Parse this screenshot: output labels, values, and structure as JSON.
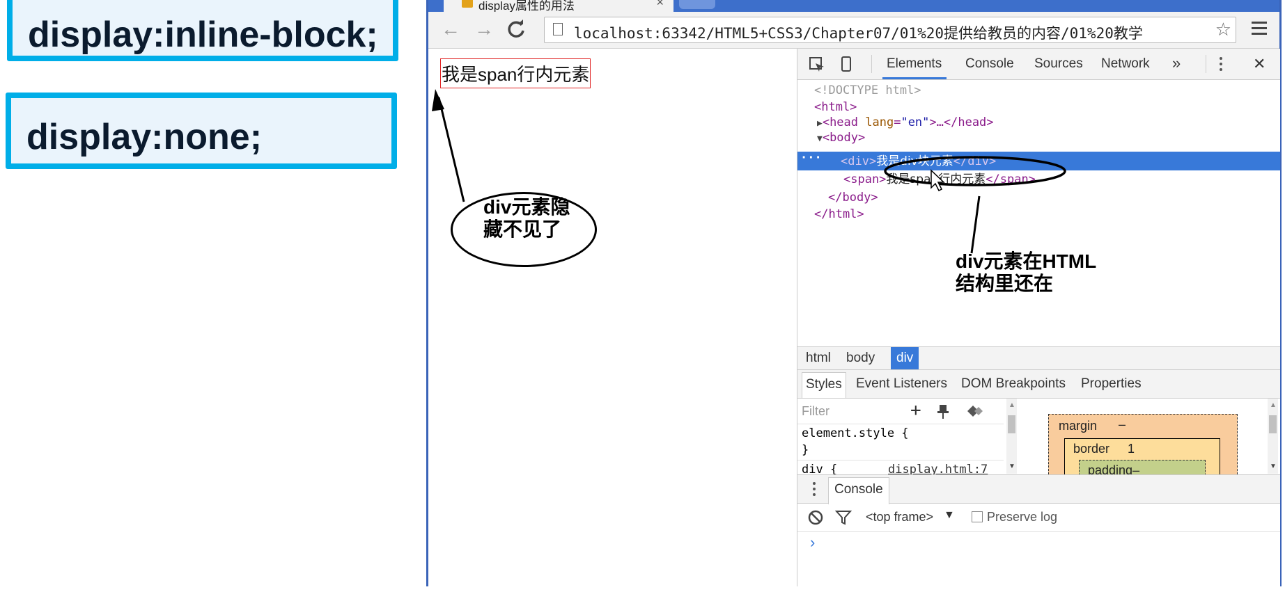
{
  "slide": {
    "box1": "display:inline-block;",
    "box2": "display:none;"
  },
  "browser": {
    "tab_title": "display属性的用法",
    "tab_close": "×",
    "url": "localhost:63342/HTML5+CSS3/Chapter07/01%20提供给教员的内容/01%20教学",
    "back": "←",
    "forward": "→",
    "reload": "C",
    "star": "☆"
  },
  "viewport": {
    "span_text": "我是span行内元素"
  },
  "devtools": {
    "tabs": [
      "Elements",
      "Console",
      "Sources",
      "Network"
    ],
    "more": "»",
    "close": "✕",
    "dom": {
      "doctype": "<!DOCTYPE html>",
      "html_open": "<html>",
      "head_tag": "<head ",
      "head_attr": "lang",
      "head_val": "\"en\"",
      "head_rest": ">…</head>",
      "body_open": "<body>",
      "div_open": "<div>",
      "div_text": "我是div块元素",
      "div_close": "</div>",
      "span_open": "<span>",
      "span_text": "我是span行内元素",
      "span_close": "</span>",
      "body_close": "</body>",
      "html_close": "</html>",
      "dots": "···"
    },
    "breadcrumbs": [
      "html",
      "body",
      "div"
    ],
    "subtabs": [
      "Styles",
      "Event Listeners",
      "DOM Breakpoints",
      "Properties"
    ],
    "styles": {
      "filter_placeholder": "Filter",
      "element_style": "element.style {",
      "close_brace": "}",
      "div_rule": "div {",
      "source": "display.html:7"
    },
    "box_model": {
      "margin": "margin",
      "margin_val": "–",
      "border": "border",
      "border_val": "1",
      "padding": "padding–"
    },
    "console": {
      "title": "Console",
      "frame": "<top frame>",
      "preserve": "Preserve log",
      "prompt": "›"
    }
  },
  "annotations": {
    "left_line1": "div元素隐",
    "left_line2": "藏不见了",
    "right_line1": "div元素在HTML",
    "right_line2": "结构里还在"
  }
}
